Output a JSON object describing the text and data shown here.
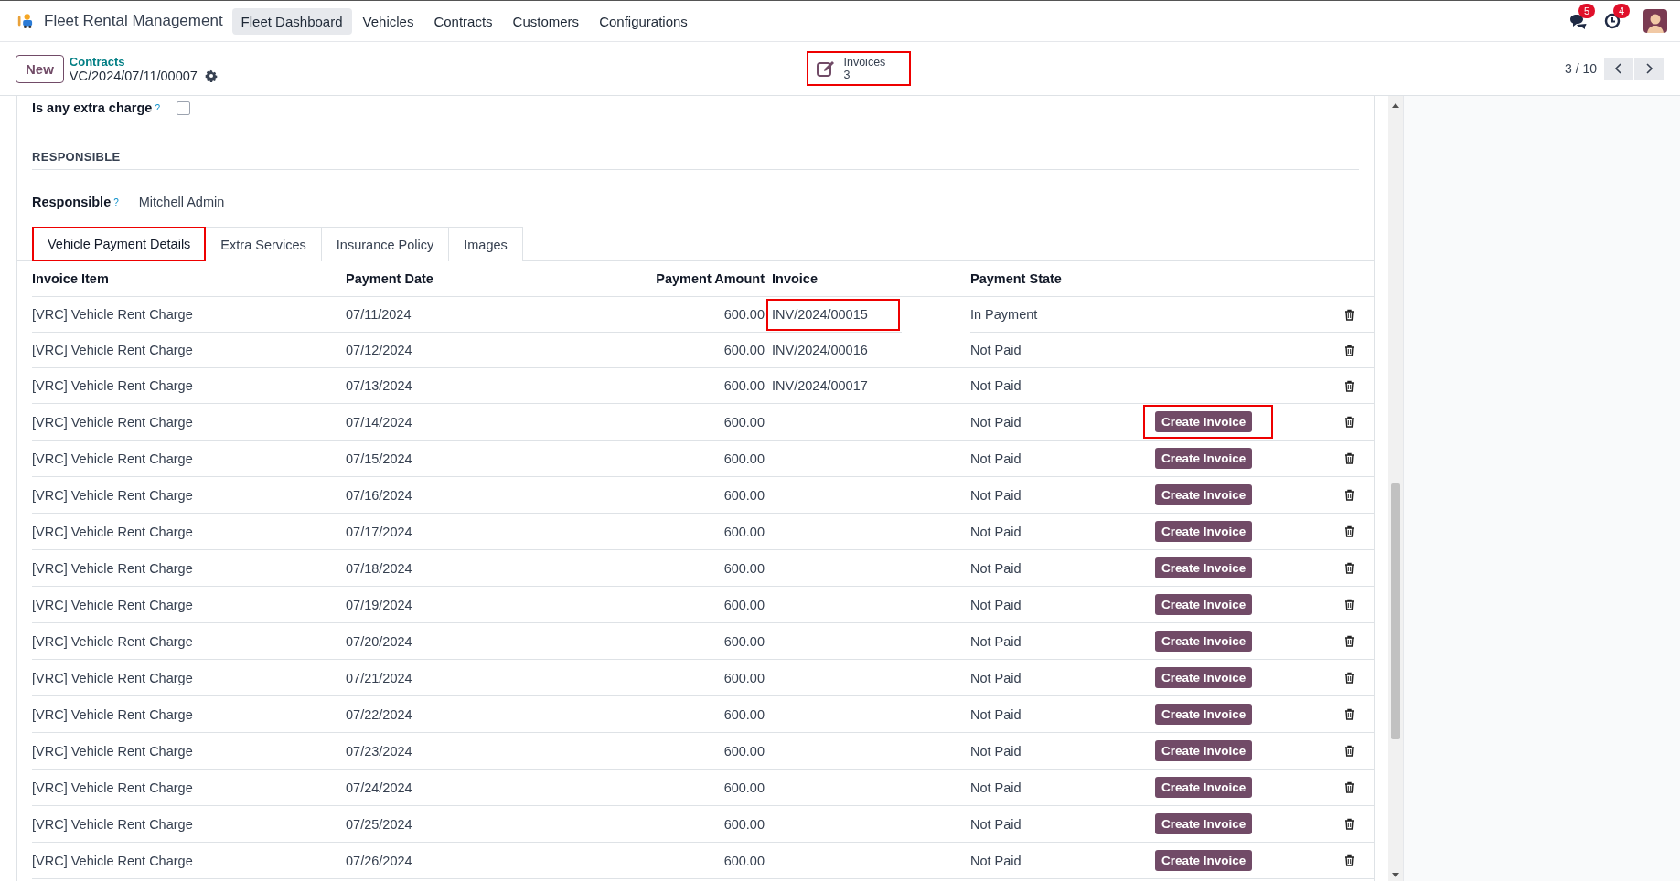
{
  "navbar": {
    "app_name": "Fleet Rental Management",
    "menu": [
      {
        "label": "Fleet Dashboard",
        "selected": true
      },
      {
        "label": "Vehicles",
        "selected": false
      },
      {
        "label": "Contracts",
        "selected": false
      },
      {
        "label": "Customers",
        "selected": false
      },
      {
        "label": "Configurations",
        "selected": false
      }
    ],
    "messages_badge": "5",
    "activities_badge": "4"
  },
  "control_panel": {
    "new_button": "New",
    "breadcrumb": "Contracts",
    "record_name": "VC/2024/07/11/00007",
    "smart_button": {
      "label": "Invoices",
      "count": "3",
      "highlighted": true
    },
    "pager": "3 / 10"
  },
  "form": {
    "extra_charge": {
      "label": "Is any extra charge",
      "help": "?",
      "checked": false
    },
    "section_title": "RESPONSIBLE",
    "responsible": {
      "label": "Responsible",
      "help": "?",
      "value": "Mitchell Admin"
    },
    "tabs": [
      {
        "label": "Vehicle Payment Details",
        "selected": true,
        "highlighted": true
      },
      {
        "label": "Extra Services",
        "selected": false,
        "highlighted": false
      },
      {
        "label": "Insurance Policy",
        "selected": false,
        "highlighted": false
      },
      {
        "label": "Images",
        "selected": false,
        "highlighted": false
      }
    ],
    "table": {
      "columns": [
        "Invoice Item",
        "Payment Date",
        "Payment Amount",
        "Invoice",
        "Payment State"
      ],
      "rows": [
        {
          "invoice_item": "[VRC] Vehicle Rent Charge",
          "payment_date": "07/11/2024",
          "payment_amount": "600.00",
          "invoice": "INV/2024/00015",
          "invoice_highlighted": true,
          "payment_state": "In Payment"
        },
        {
          "invoice_item": "[VRC] Vehicle Rent Charge",
          "payment_date": "07/12/2024",
          "payment_amount": "600.00",
          "invoice": "INV/2024/00016",
          "invoice_highlighted": false,
          "payment_state": "Not Paid"
        },
        {
          "invoice_item": "[VRC] Vehicle Rent Charge",
          "payment_date": "07/13/2024",
          "payment_amount": "600.00",
          "invoice": "INV/2024/00017",
          "invoice_highlighted": false,
          "payment_state": "Not Paid"
        },
        {
          "invoice_item": "[VRC] Vehicle Rent Charge",
          "payment_date": "07/14/2024",
          "payment_amount": "600.00",
          "payment_state": "Not Paid",
          "action": "Create Invoice",
          "action_highlighted": true
        },
        {
          "invoice_item": "[VRC] Vehicle Rent Charge",
          "payment_date": "07/15/2024",
          "payment_amount": "600.00",
          "payment_state": "Not Paid",
          "action": "Create Invoice"
        },
        {
          "invoice_item": "[VRC] Vehicle Rent Charge",
          "payment_date": "07/16/2024",
          "payment_amount": "600.00",
          "payment_state": "Not Paid",
          "action": "Create Invoice"
        },
        {
          "invoice_item": "[VRC] Vehicle Rent Charge",
          "payment_date": "07/17/2024",
          "payment_amount": "600.00",
          "payment_state": "Not Paid",
          "action": "Create Invoice"
        },
        {
          "invoice_item": "[VRC] Vehicle Rent Charge",
          "payment_date": "07/18/2024",
          "payment_amount": "600.00",
          "payment_state": "Not Paid",
          "action": "Create Invoice"
        },
        {
          "invoice_item": "[VRC] Vehicle Rent Charge",
          "payment_date": "07/19/2024",
          "payment_amount": "600.00",
          "payment_state": "Not Paid",
          "action": "Create Invoice"
        },
        {
          "invoice_item": "[VRC] Vehicle Rent Charge",
          "payment_date": "07/20/2024",
          "payment_amount": "600.00",
          "payment_state": "Not Paid",
          "action": "Create Invoice"
        },
        {
          "invoice_item": "[VRC] Vehicle Rent Charge",
          "payment_date": "07/21/2024",
          "payment_amount": "600.00",
          "payment_state": "Not Paid",
          "action": "Create Invoice"
        },
        {
          "invoice_item": "[VRC] Vehicle Rent Charge",
          "payment_date": "07/22/2024",
          "payment_amount": "600.00",
          "payment_state": "Not Paid",
          "action": "Create Invoice"
        },
        {
          "invoice_item": "[VRC] Vehicle Rent Charge",
          "payment_date": "07/23/2024",
          "payment_amount": "600.00",
          "payment_state": "Not Paid",
          "action": "Create Invoice"
        },
        {
          "invoice_item": "[VRC] Vehicle Rent Charge",
          "payment_date": "07/24/2024",
          "payment_amount": "600.00",
          "payment_state": "Not Paid",
          "action": "Create Invoice"
        },
        {
          "invoice_item": "[VRC] Vehicle Rent Charge",
          "payment_date": "07/25/2024",
          "payment_amount": "600.00",
          "payment_state": "Not Paid",
          "action": "Create Invoice"
        },
        {
          "invoice_item": "[VRC] Vehicle Rent Charge",
          "payment_date": "07/26/2024",
          "payment_amount": "600.00",
          "payment_state": "Not Paid",
          "action": "Create Invoice"
        }
      ]
    }
  }
}
